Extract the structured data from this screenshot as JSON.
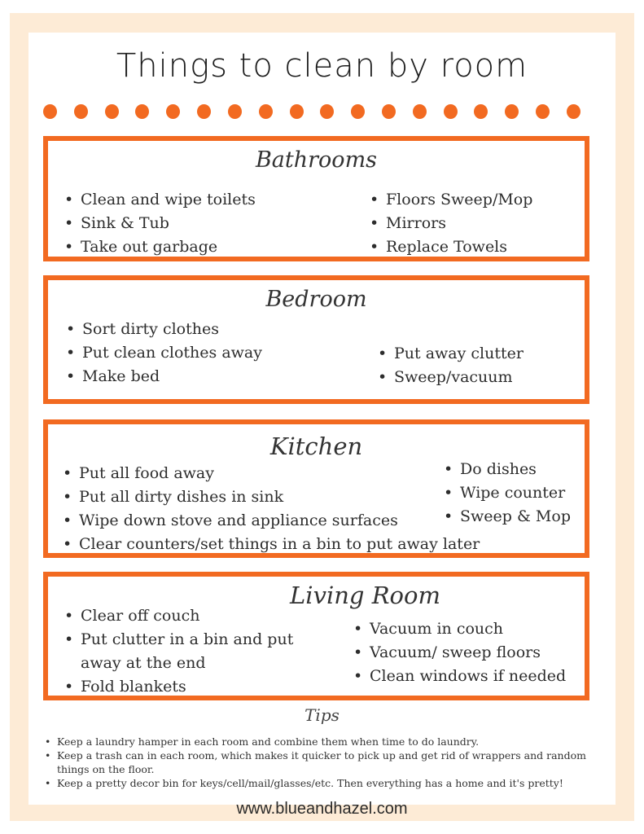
{
  "title": "Things to clean by room",
  "dot_count": 18,
  "accent_color": "#f26a21",
  "frame_color": "#fdebd6",
  "rooms": {
    "bathrooms": {
      "title": "Bathrooms",
      "left": [
        "Clean and wipe toilets",
        "Sink & Tub",
        "Take out garbage"
      ],
      "right": [
        "Floors Sweep/Mop",
        "Mirrors",
        "Replace Towels"
      ]
    },
    "bedroom": {
      "title": "Bedroom",
      "left": [
        "Sort dirty clothes",
        "Put clean clothes away",
        "Make bed"
      ],
      "right": [
        "Put away clutter",
        "Sweep/vacuum"
      ]
    },
    "kitchen": {
      "title": "Kitchen",
      "left": [
        "Put all food away",
        "Put all dirty dishes in sink",
        "Wipe down stove and appliance surfaces",
        "Clear counters/set things in a bin to put away later"
      ],
      "right": [
        "Do dishes",
        "Wipe counter",
        "Sweep & Mop"
      ]
    },
    "living_room": {
      "title": "Living Room",
      "left": [
        "Clear off couch",
        "Put clutter in a bin and put away at the end",
        "Fold blankets"
      ],
      "right": [
        "Vacuum in couch",
        "Vacuum/ sweep floors",
        "Clean windows if needed"
      ]
    }
  },
  "tips": {
    "title": "Tips",
    "items": [
      "Keep a laundry hamper in each room and combine them when time to do laundry.",
      "Keep a trash can in each room, which makes it quicker to pick up and get rid of wrappers and random things on the floor.",
      "Keep a pretty decor bin for keys/cell/mail/glasses/etc. Then everything has a home and it's pretty!"
    ]
  },
  "website": "www.blueandhazel.com"
}
